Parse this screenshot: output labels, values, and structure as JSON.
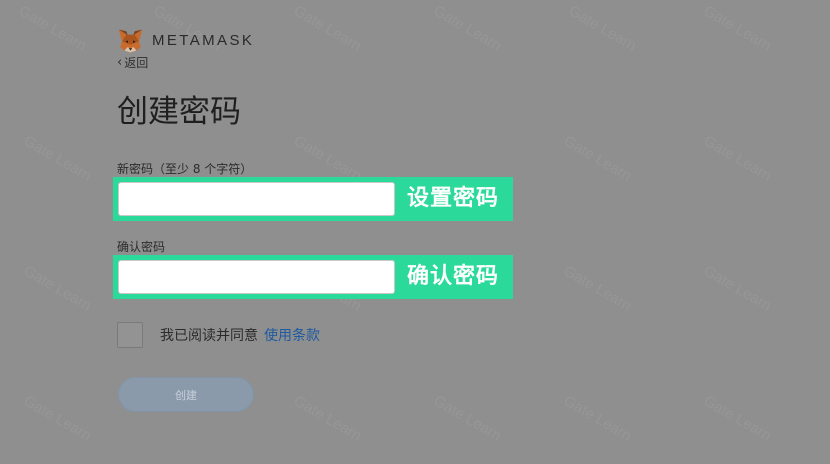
{
  "brand": {
    "name": "METAMASK"
  },
  "nav": {
    "back_label": "返回"
  },
  "page": {
    "title": "创建密码"
  },
  "form": {
    "new_password": {
      "label": "新密码（至少 8 个字符）",
      "value": "",
      "annotation": "设置密码"
    },
    "confirm_password": {
      "label": "确认密码",
      "value": "",
      "annotation": "确认密码"
    },
    "agreement": {
      "checked": false,
      "text": "我已阅读并同意",
      "link": "使用条款"
    },
    "submit": {
      "label": "创建",
      "enabled": false
    }
  },
  "watermark": {
    "text": "Gate Learn"
  },
  "colors": {
    "highlight": "#2bd99a",
    "link": "#1d5aa0",
    "disabled_button": "#8a9aab",
    "overlay": "#8f8f8f"
  },
  "icons": {
    "logo": "metamask-fox-icon",
    "back": "chevron-left-icon"
  }
}
